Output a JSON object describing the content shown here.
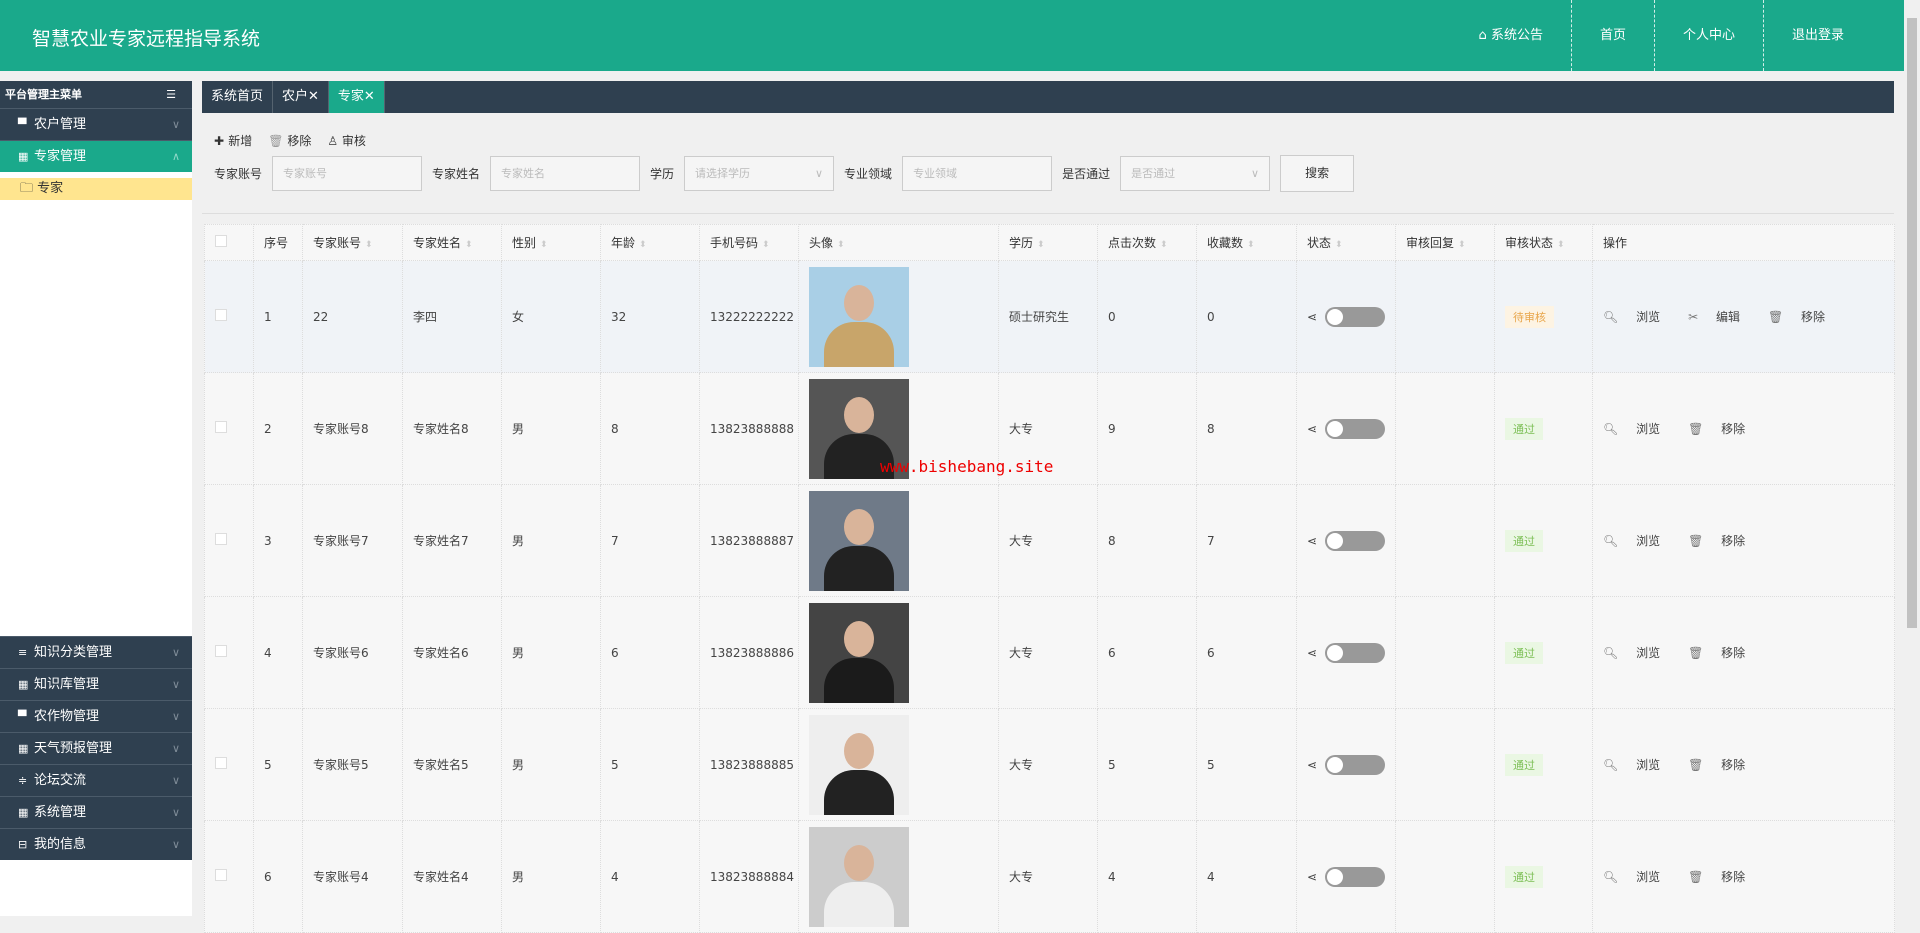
{
  "header": {
    "title": "智慧农业专家远程指导系统",
    "nav": [
      "系统公告",
      "首页",
      "个人中心",
      "退出登录"
    ]
  },
  "sidebar": {
    "title": "平台管理主菜单",
    "top": [
      {
        "label": "农户管理"
      },
      {
        "label": "专家管理"
      }
    ],
    "sub": "专家",
    "lower": [
      {
        "label": "知识分类管理"
      },
      {
        "label": "知识库管理"
      },
      {
        "label": "农作物管理"
      },
      {
        "label": "天气预报管理"
      },
      {
        "label": "论坛交流"
      },
      {
        "label": "系统管理"
      },
      {
        "label": "我的信息"
      }
    ]
  },
  "tabs": [
    "系统首页",
    "农户✕",
    "专家✕"
  ],
  "toolbar": {
    "add": "新增",
    "remove": "移除",
    "audit": "审核"
  },
  "filters": {
    "account_label": "专家账号",
    "account_ph": "专家账号",
    "name_label": "专家姓名",
    "name_ph": "专家姓名",
    "edu_label": "学历",
    "edu_ph": "请选择学历",
    "field_label": "专业领域",
    "field_ph": "专业领域",
    "pass_label": "是否通过",
    "pass_ph": "是否通过",
    "search": "搜索"
  },
  "columns": [
    "序号",
    "专家账号",
    "专家姓名",
    "性别",
    "年龄",
    "手机号码",
    "头像",
    "学历",
    "点击次数",
    "收藏数",
    "状态",
    "审核回复",
    "审核状态",
    "操作"
  ],
  "rows": [
    {
      "no": "1",
      "account": "22",
      "name": "李四",
      "gender": "女",
      "age": "32",
      "phone": "13222222222",
      "edu": "硕士研究生",
      "clicks": "0",
      "favs": "0",
      "reply": "",
      "status": "待审核",
      "ops": [
        "浏览",
        "编辑",
        "移除"
      ]
    },
    {
      "no": "2",
      "account": "专家账号8",
      "name": "专家姓名8",
      "gender": "男",
      "age": "8",
      "phone": "13823888888",
      "edu": "大专",
      "clicks": "9",
      "favs": "8",
      "reply": "",
      "status": "通过",
      "ops": [
        "浏览",
        "移除"
      ]
    },
    {
      "no": "3",
      "account": "专家账号7",
      "name": "专家姓名7",
      "gender": "男",
      "age": "7",
      "phone": "13823888887",
      "edu": "大专",
      "clicks": "8",
      "favs": "7",
      "reply": "",
      "status": "通过",
      "ops": [
        "浏览",
        "移除"
      ]
    },
    {
      "no": "4",
      "account": "专家账号6",
      "name": "专家姓名6",
      "gender": "男",
      "age": "6",
      "phone": "13823888886",
      "edu": "大专",
      "clicks": "6",
      "favs": "6",
      "reply": "",
      "status": "通过",
      "ops": [
        "浏览",
        "移除"
      ]
    },
    {
      "no": "5",
      "account": "专家账号5",
      "name": "专家姓名5",
      "gender": "男",
      "age": "5",
      "phone": "13823888885",
      "edu": "大专",
      "clicks": "5",
      "favs": "5",
      "reply": "",
      "status": "通过",
      "ops": [
        "浏览",
        "移除"
      ]
    },
    {
      "no": "6",
      "account": "专家账号4",
      "name": "专家姓名4",
      "gender": "男",
      "age": "4",
      "phone": "13823888884",
      "edu": "大专",
      "clicks": "4",
      "favs": "4",
      "reply": "",
      "status": "通过",
      "ops": [
        "浏览",
        "移除"
      ]
    }
  ],
  "watermark": "www.bishebang.site"
}
